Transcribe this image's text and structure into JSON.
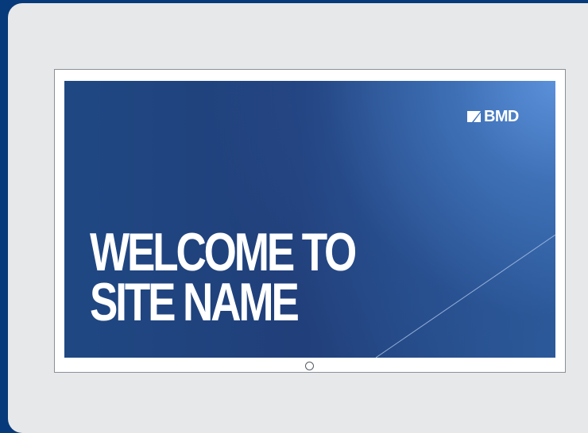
{
  "screen": {
    "logo_text": "BMD",
    "headline_line_1": "WELCOME TO",
    "headline_line_2": "SITE NAME"
  },
  "icons": {
    "logo": "bmd-logo-icon",
    "device_home": "home-button-icon"
  },
  "colors": {
    "outer_background": "#073a7a",
    "panel_background": "#e7e8ea",
    "screen_blue": "#213f7a",
    "screen_highlight": "#5c92db",
    "text": "#ffffff",
    "frame_border": "#8a8f98"
  }
}
